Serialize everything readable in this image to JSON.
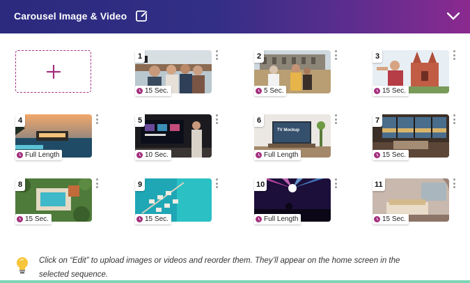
{
  "header": {
    "title": "Carousel Image & Video",
    "edit_icon": "edit-icon",
    "collapse_icon": "chevron-down-icon"
  },
  "add_tile": {
    "icon": "plus-icon"
  },
  "items": [
    {
      "number": "1",
      "duration": "15 Sec."
    },
    {
      "number": "2",
      "duration": "5 Sec."
    },
    {
      "number": "3",
      "duration": "15 Sec."
    },
    {
      "number": "4",
      "duration": "Full Length"
    },
    {
      "number": "5",
      "duration": "10 Sec."
    },
    {
      "number": "6",
      "duration": "Full Length"
    },
    {
      "number": "7",
      "duration": "15 Sec."
    },
    {
      "number": "8",
      "duration": "15 Sec."
    },
    {
      "number": "9",
      "duration": "15 Sec."
    },
    {
      "number": "10",
      "duration": "Full Length"
    },
    {
      "number": "11",
      "duration": "15 Sec."
    }
  ],
  "thumbnail_mockup_text": "TV Mockup",
  "hint": {
    "icon": "lightbulb-icon",
    "text": "Click on “Edit” to upload images or videos and reorder them. They’ll appear on the home screen in the selected sequence."
  },
  "colors": {
    "header_start": "#2b2a7e",
    "header_end": "#8b2a8f",
    "accent": "#a4307e",
    "bottom_bar": "#7fd6b7"
  }
}
